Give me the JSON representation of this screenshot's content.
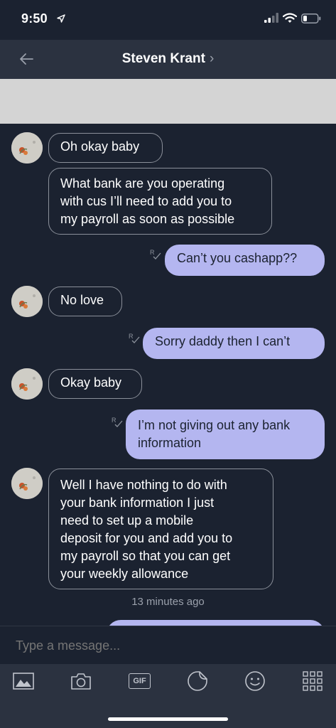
{
  "status": {
    "time": "9:50"
  },
  "header": {
    "contact_name": "Steven Krant",
    "chevron": "›"
  },
  "messages": [
    {
      "dir": "in",
      "text": "Oh okay baby"
    },
    {
      "dir": "in",
      "lines": [
        "What bank are you operating",
        "with cus I’ll need to add you to",
        "my payroll as soon as possible"
      ]
    },
    {
      "dir": "out",
      "text": "Can’t you cashapp??"
    },
    {
      "dir": "in",
      "text": "No love"
    },
    {
      "dir": "out",
      "text": "Sorry daddy then I can’t"
    },
    {
      "dir": "in",
      "text": "Okay baby"
    },
    {
      "dir": "out",
      "lines": [
        "I’m not giving out any bank",
        "information"
      ]
    },
    {
      "dir": "in",
      "lines": [
        "Well I have nothing to do with",
        "your bank information I just",
        "need to set up a mobile",
        "deposit for you and add you to",
        "my payroll so that you can get",
        "your weekly allowance"
      ]
    }
  ],
  "timestamp": "13 minutes ago",
  "compose": {
    "placeholder": "Type a message..."
  },
  "toolbar": {
    "gif_label": "GIF"
  },
  "icons": [
    "back-arrow-icon",
    "chevron-right-icon",
    "location-arrow-icon",
    "signal-icon",
    "wifi-icon",
    "battery-icon",
    "read-receipt-icon",
    "image-icon",
    "camera-icon",
    "gif-icon",
    "sticker-icon",
    "emoji-icon",
    "apps-grid-icon"
  ],
  "colors": {
    "background": "#1b2230",
    "bar": "#2b3240",
    "outgoing_bubble": "#b4b6f0",
    "incoming_border": "#8b909a",
    "banner": "#d4d4d4"
  }
}
